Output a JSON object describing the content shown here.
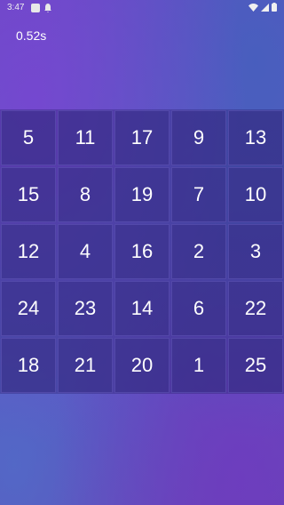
{
  "status_bar": {
    "time": "3:47",
    "icons": [
      "app-icon",
      "notification-icon",
      "wifi-icon",
      "signal-icon",
      "battery-icon"
    ]
  },
  "timer": {
    "value": "0.52s"
  },
  "board": {
    "rows": 5,
    "cols": 5,
    "tiles": [
      "5",
      "11",
      "17",
      "9",
      "13",
      "15",
      "8",
      "19",
      "7",
      "10",
      "12",
      "4",
      "16",
      "2",
      "3",
      "24",
      "23",
      "14",
      "6",
      "22",
      "18",
      "21",
      "20",
      "1",
      "25"
    ]
  },
  "colors": {
    "background_primary": "#5b55c0",
    "background_secondary": "#6a45b8",
    "tile_fill": "#3b3288",
    "text": "#ffffff"
  }
}
